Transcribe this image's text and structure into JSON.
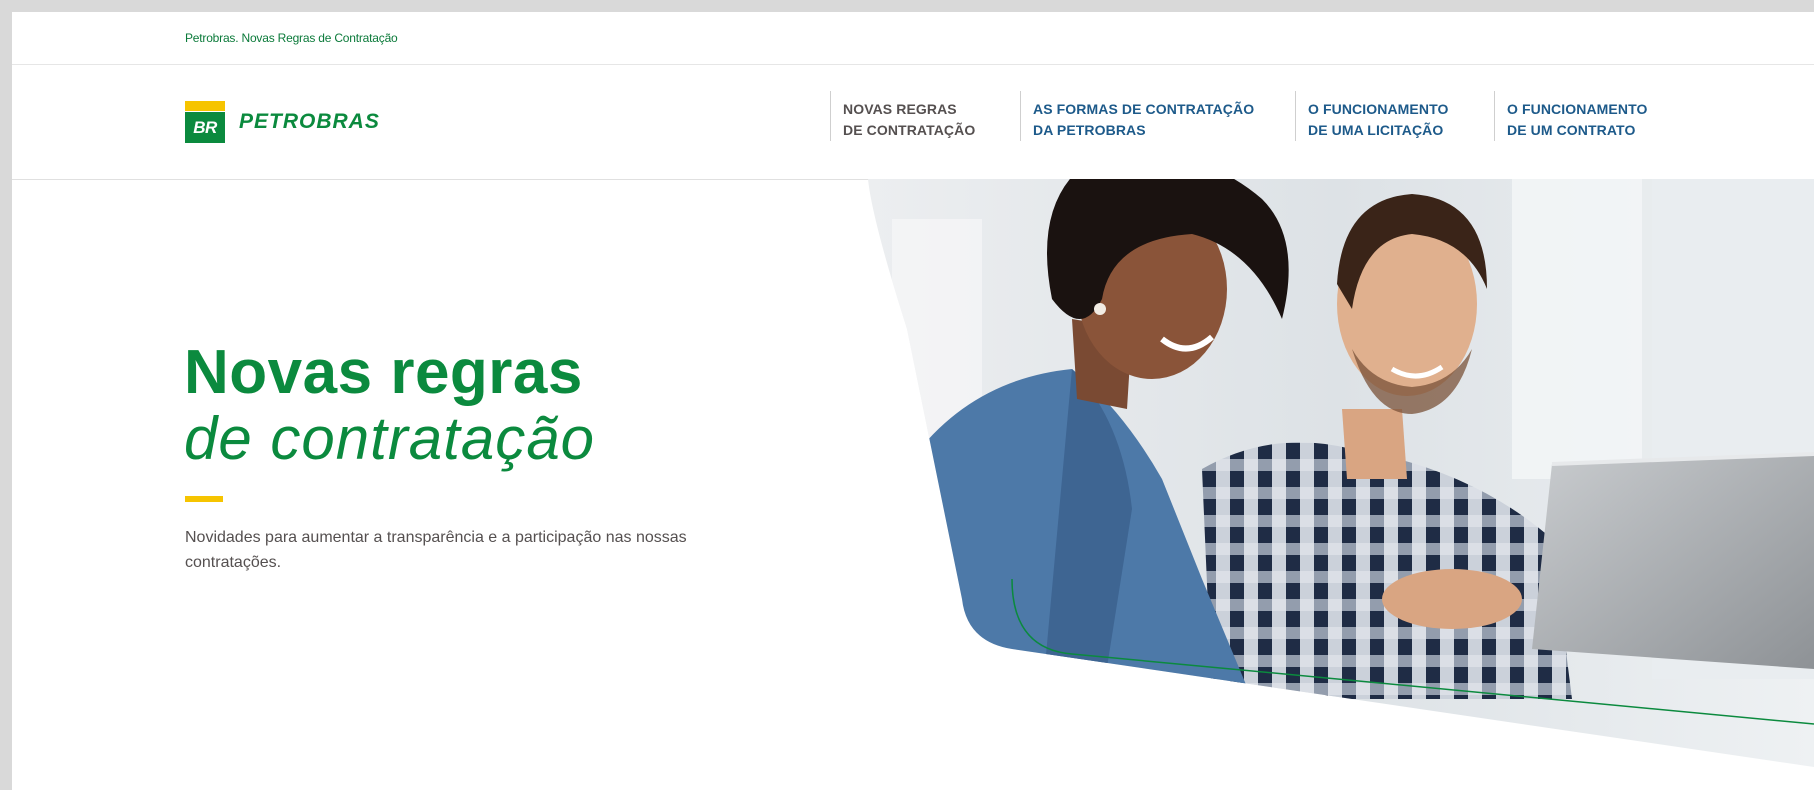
{
  "topbar": {
    "title": "Petrobras. Novas Regras de Contratação"
  },
  "header": {
    "logo_mark": "BR",
    "logo_text": "PETROBRAS",
    "nav": [
      {
        "line1": "NOVAS REGRAS",
        "line2": "DE CONTRATAÇÃO"
      },
      {
        "line1": "AS FORMAS DE CONTRATAÇÃO",
        "line2": "DA PETROBRAS"
      },
      {
        "line1": "O FUNCIONAMENTO",
        "line2": "DE UMA LICITAÇÃO"
      },
      {
        "line1": "O FUNCIONAMENTO",
        "line2": "DE UM CONTRATO"
      }
    ]
  },
  "hero": {
    "title_bold": "Novas regras",
    "title_italic": "de contratação",
    "description": "Novidades para aumentar a transparência e a participação nas nossas contratações."
  },
  "colors": {
    "brand_green": "#0b8a3e",
    "brand_yellow": "#f6c400",
    "nav_link": "#1d5a8a",
    "text_gray": "#555050"
  }
}
